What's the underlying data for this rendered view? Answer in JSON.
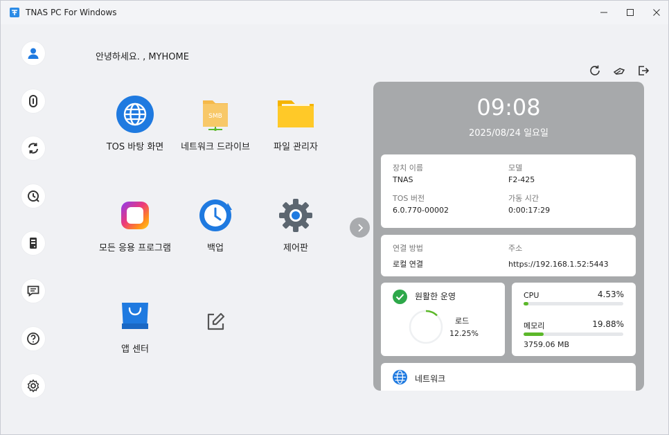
{
  "window": {
    "title": "TNAS PC For Windows"
  },
  "sidebar": {
    "items": [
      {
        "name": "user-icon"
      },
      {
        "name": "tnas-logo-icon"
      },
      {
        "name": "sync-icon"
      },
      {
        "name": "backup-clock-icon"
      },
      {
        "name": "nas-device-icon"
      },
      {
        "name": "message-icon"
      },
      {
        "name": "help-icon"
      },
      {
        "name": "settings-icon"
      }
    ]
  },
  "greeting": "안녕하세요.  , MYHOME",
  "apps": [
    {
      "label": "TOS 바탕 화면",
      "icon": "globe-icon"
    },
    {
      "label": "네트워크 드라이브",
      "icon": "smb-folder-icon"
    },
    {
      "label": "파일 관리자",
      "icon": "folder-icon"
    },
    {
      "label": "모든 응용 프로그램",
      "icon": "apps-icon"
    },
    {
      "label": "백업",
      "icon": "backup-icon"
    },
    {
      "label": "제어판",
      "icon": "gear-icon"
    },
    {
      "label": "앱 센터",
      "icon": "shopping-bag-icon"
    },
    {
      "label": "",
      "icon": "edit-icon"
    }
  ],
  "smb_label": "SMB",
  "panel": {
    "time": "09:08",
    "date": "2025/08/24 일요일",
    "device": {
      "name_label": "장치 이름",
      "name_value": "TNAS",
      "model_label": "모델",
      "model_value": "F2-425",
      "tos_label": "TOS 버전",
      "tos_value": "6.0.770-00002",
      "uptime_label": "가동 시간",
      "uptime_value": "0:00:17:29"
    },
    "connection": {
      "method_label": "연결 방법",
      "method_value": "로컬 연결",
      "address_label": "주소",
      "address_value": "https://192.168.1.52:5443"
    },
    "status": {
      "label": "원활한 운영",
      "load_label": "로드",
      "load_value": "12.25%",
      "load_fraction": 0.1225
    },
    "resources": {
      "cpu_label": "CPU",
      "cpu_value": "4.53%",
      "cpu_fraction": 0.0453,
      "mem_label": "메모리",
      "mem_value": "19.88%",
      "mem_fraction": 0.1988,
      "mem_amount": "3759.06 MB"
    },
    "network_label": "네트워크"
  },
  "colors": {
    "accent_green": "#5cb82a",
    "panel_bg": "#a7a9ab",
    "blue": "#1f7ae0"
  }
}
